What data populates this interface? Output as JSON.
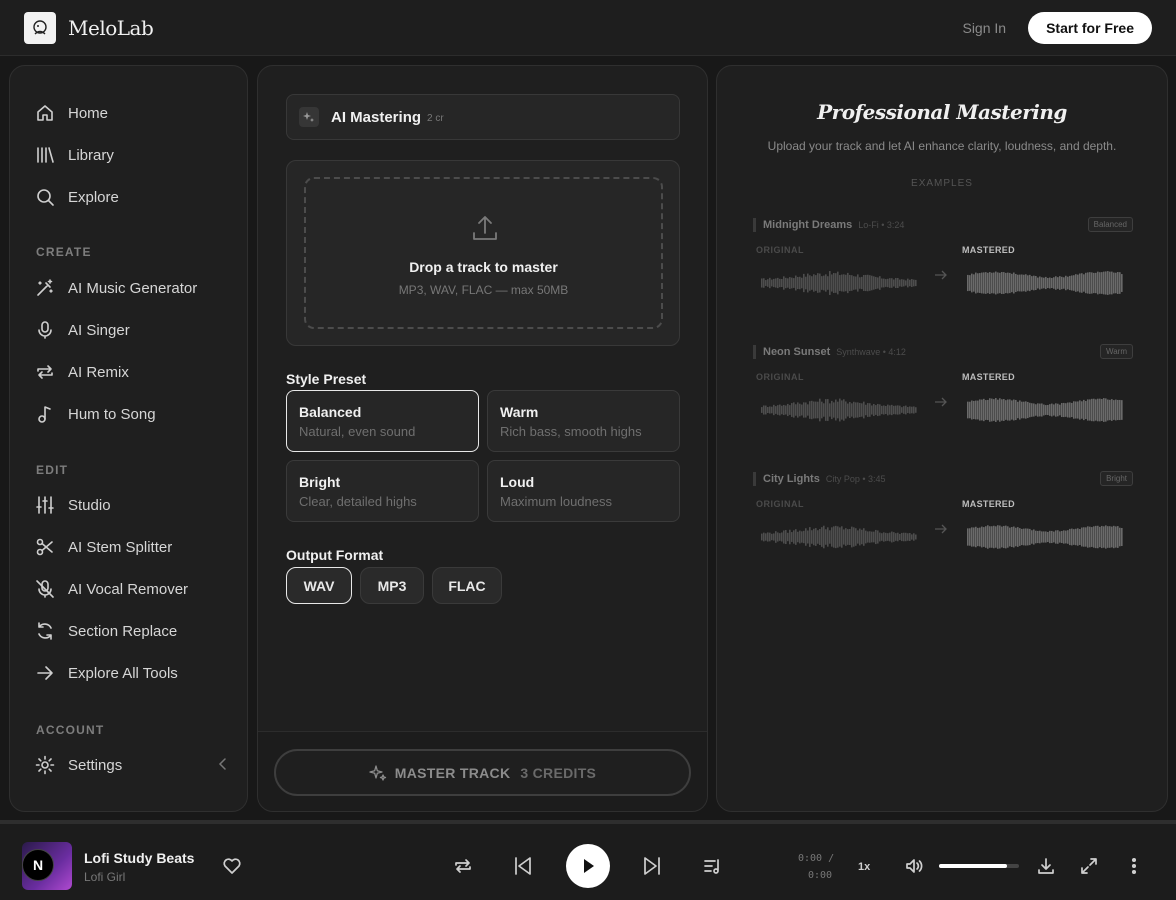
{
  "header": {
    "brand": "MeloLab",
    "sign_in": "Sign In",
    "start_free": "Start for Free"
  },
  "sidebar": {
    "main": [
      {
        "label": "Home",
        "icon": "home-icon"
      },
      {
        "label": "Library",
        "icon": "library-icon"
      },
      {
        "label": "Explore",
        "icon": "search-icon"
      }
    ],
    "create_title": "CREATE",
    "create": [
      {
        "label": "AI Music Generator",
        "icon": "magic-wand-icon"
      },
      {
        "label": "AI Singer",
        "icon": "microphone-icon"
      },
      {
        "label": "AI Remix",
        "icon": "repeat-icon"
      },
      {
        "label": "Hum to Song",
        "icon": "music-note-icon"
      }
    ],
    "edit_title": "EDIT",
    "edit": [
      {
        "label": "Studio",
        "icon": "sliders-icon"
      },
      {
        "label": "AI Stem Splitter",
        "icon": "scissors-icon"
      },
      {
        "label": "AI Vocal Remover",
        "icon": "mic-off-icon"
      },
      {
        "label": "Section Replace",
        "icon": "refresh-icon"
      },
      {
        "label": "Explore All Tools",
        "icon": "arrow-right-icon"
      }
    ],
    "account_title": "ACCOUNT",
    "account": [
      {
        "label": "Settings",
        "icon": "gear-icon"
      }
    ]
  },
  "tool": {
    "title": "AI Mastering",
    "credits": "2 cr",
    "drop_title": "Drop a track to master",
    "drop_sub": "MP3, WAV, FLAC — max 50MB",
    "style_label": "Style Preset",
    "presets": [
      {
        "name": "Balanced",
        "desc": "Natural, even sound",
        "selected": true
      },
      {
        "name": "Warm",
        "desc": "Rich bass, smooth highs",
        "selected": false
      },
      {
        "name": "Bright",
        "desc": "Clear, detailed highs",
        "selected": false
      },
      {
        "name": "Loud",
        "desc": "Maximum loudness",
        "selected": false
      }
    ],
    "format_label": "Output Format",
    "formats": [
      {
        "label": "WAV",
        "selected": true
      },
      {
        "label": "MP3",
        "selected": false
      },
      {
        "label": "FLAC",
        "selected": false
      }
    ],
    "master_label": "MASTER TRACK",
    "master_credits": "3 CREDITS"
  },
  "showcase": {
    "title": "Professional Mastering",
    "subtitle": "Upload your track and let AI enhance clarity, loudness, and depth.",
    "examples_label": "EXAMPLES",
    "original_label": "ORIGINAL",
    "mastered_label": "MASTERED",
    "examples": [
      {
        "name": "Midnight Dreams",
        "meta": "Lo-Fi • 3:24",
        "badge": "Balanced"
      },
      {
        "name": "Neon Sunset",
        "meta": "Synthwave • 4:12",
        "badge": "Warm"
      },
      {
        "name": "City Lights",
        "meta": "City Pop • 3:45",
        "badge": "Bright"
      }
    ]
  },
  "player": {
    "cover_letter": "N",
    "title": "Lofi Study Beats",
    "artist": "Lofi Girl",
    "time_current": "0:00 /",
    "time_total": "0:00",
    "speed": "1x",
    "volume": 0.85
  }
}
